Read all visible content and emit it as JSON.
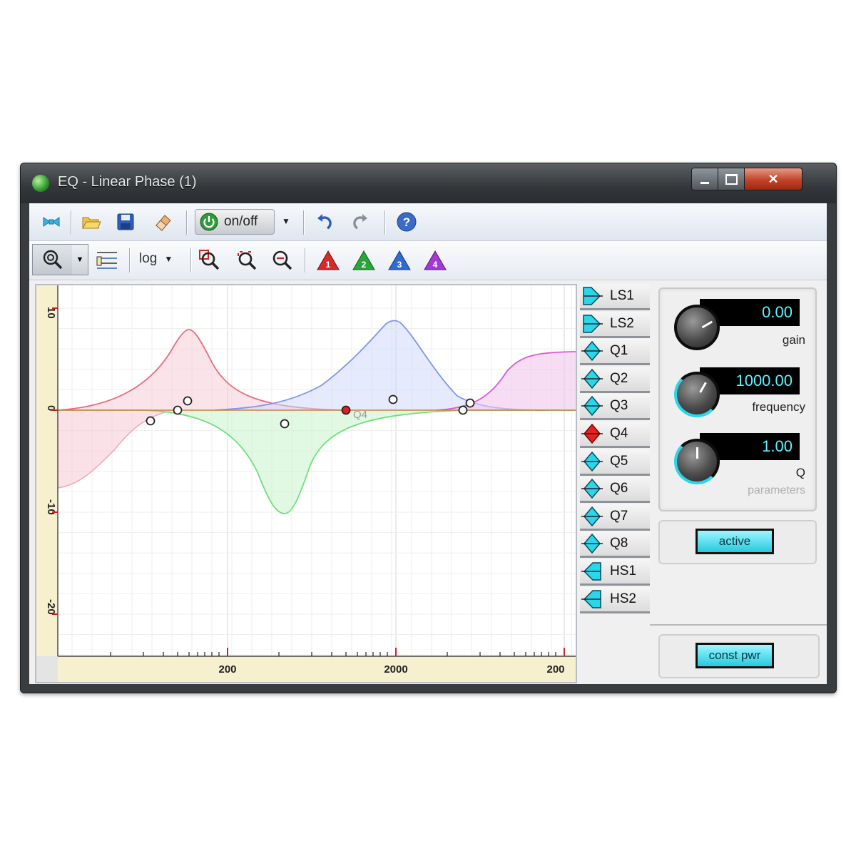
{
  "window": {
    "title": "EQ - Linear Phase (1)"
  },
  "toolbar": {
    "onoff_label": "on/off",
    "scale_value": "log"
  },
  "bands": [
    {
      "id": "LS1",
      "type": "low-shelf",
      "selected": false
    },
    {
      "id": "LS2",
      "type": "low-shelf",
      "selected": false
    },
    {
      "id": "Q1",
      "type": "peak",
      "selected": false
    },
    {
      "id": "Q2",
      "type": "peak",
      "selected": false
    },
    {
      "id": "Q3",
      "type": "peak",
      "selected": false
    },
    {
      "id": "Q4",
      "type": "peak",
      "selected": true
    },
    {
      "id": "Q5",
      "type": "peak",
      "selected": false
    },
    {
      "id": "Q6",
      "type": "peak",
      "selected": false
    },
    {
      "id": "Q7",
      "type": "peak",
      "selected": false
    },
    {
      "id": "Q8",
      "type": "peak",
      "selected": false
    },
    {
      "id": "HS1",
      "type": "high-shelf",
      "selected": false
    },
    {
      "id": "HS2",
      "type": "high-shelf",
      "selected": false
    }
  ],
  "parameters": {
    "title": "parameters",
    "gain": {
      "label": "gain",
      "value": "0.00"
    },
    "frequency": {
      "label": "frequency",
      "value": "1000.00"
    },
    "q": {
      "label": "Q",
      "value": "1.00"
    }
  },
  "active_label": "active",
  "const_pwr_label": "const pwr",
  "graph": {
    "y_ticks": [
      "10",
      "0",
      "-10",
      "-20"
    ],
    "x_ticks": [
      "200",
      "2000",
      "200"
    ],
    "selected_band_label": "Q4",
    "colors": {
      "red": "#e86a7a",
      "blue": "#7f96ee",
      "green": "#6fe07a",
      "magenta": "#d85ad0",
      "pink": "#f0a8b8",
      "flat": "#d08040"
    }
  }
}
